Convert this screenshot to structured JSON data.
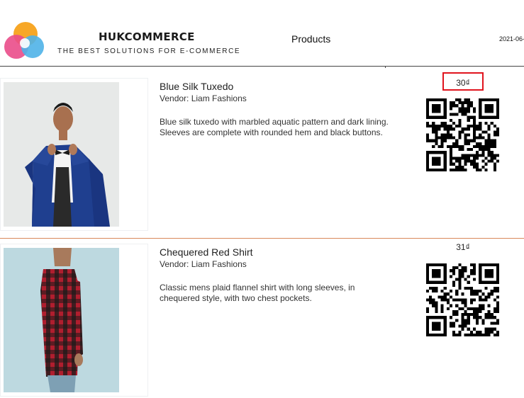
{
  "header": {
    "brand_name": "HUKCOMMERCE",
    "tagline": "THE BEST SOLUTIONS FOR E-COMMERCE",
    "title": "Products",
    "date": "2021-06-"
  },
  "products": [
    {
      "name": "Blue Silk Tuxedo",
      "vendor": "Vendor: Liam Fashions",
      "description": "Blue silk tuxedo with marbled aquatic pattern and dark lining. Sleeves are complete with rounded hem and black buttons.",
      "price": "30₫"
    },
    {
      "name": "Chequered Red Shirt",
      "vendor": "Vendor: Liam Fashions",
      "description": "Classic mens plaid flannel shirt with long sleeves, in chequered style, with two chest pockets.",
      "price": "31₫"
    }
  ],
  "colors": {
    "highlight": "#e0141e",
    "divider": "#d9895a",
    "logo_orange": "#f7a21b",
    "logo_pink": "#ea4c89",
    "logo_blue": "#4fb3e8"
  }
}
